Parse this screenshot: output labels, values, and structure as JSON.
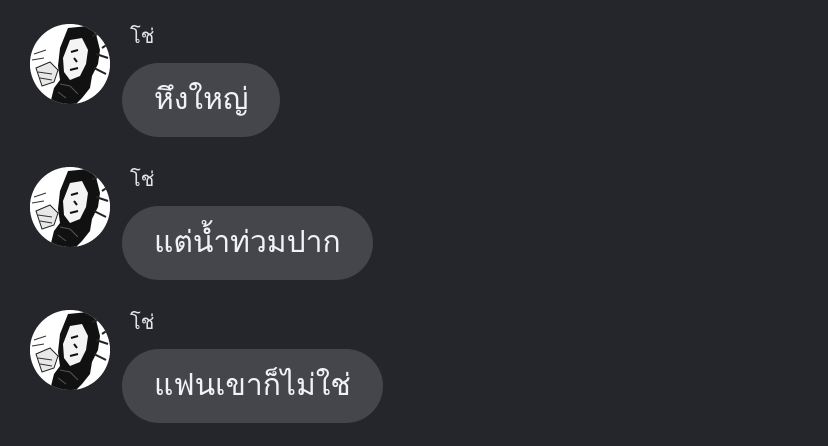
{
  "messages": [
    {
      "sender": "โช่",
      "text": "หึงใหญ่",
      "avatar_icon": "manga-character-avatar-icon"
    },
    {
      "sender": "โช่",
      "text": "แต่น้ำท่วมปาก",
      "avatar_icon": "manga-character-avatar-icon"
    },
    {
      "sender": "โช่",
      "text": "แฟนเขาก็ไม่ใช่",
      "avatar_icon": "manga-character-avatar-icon"
    }
  ],
  "colors": {
    "background": "#25262c",
    "bubble": "#45464c",
    "text": "#f2f2f4"
  }
}
